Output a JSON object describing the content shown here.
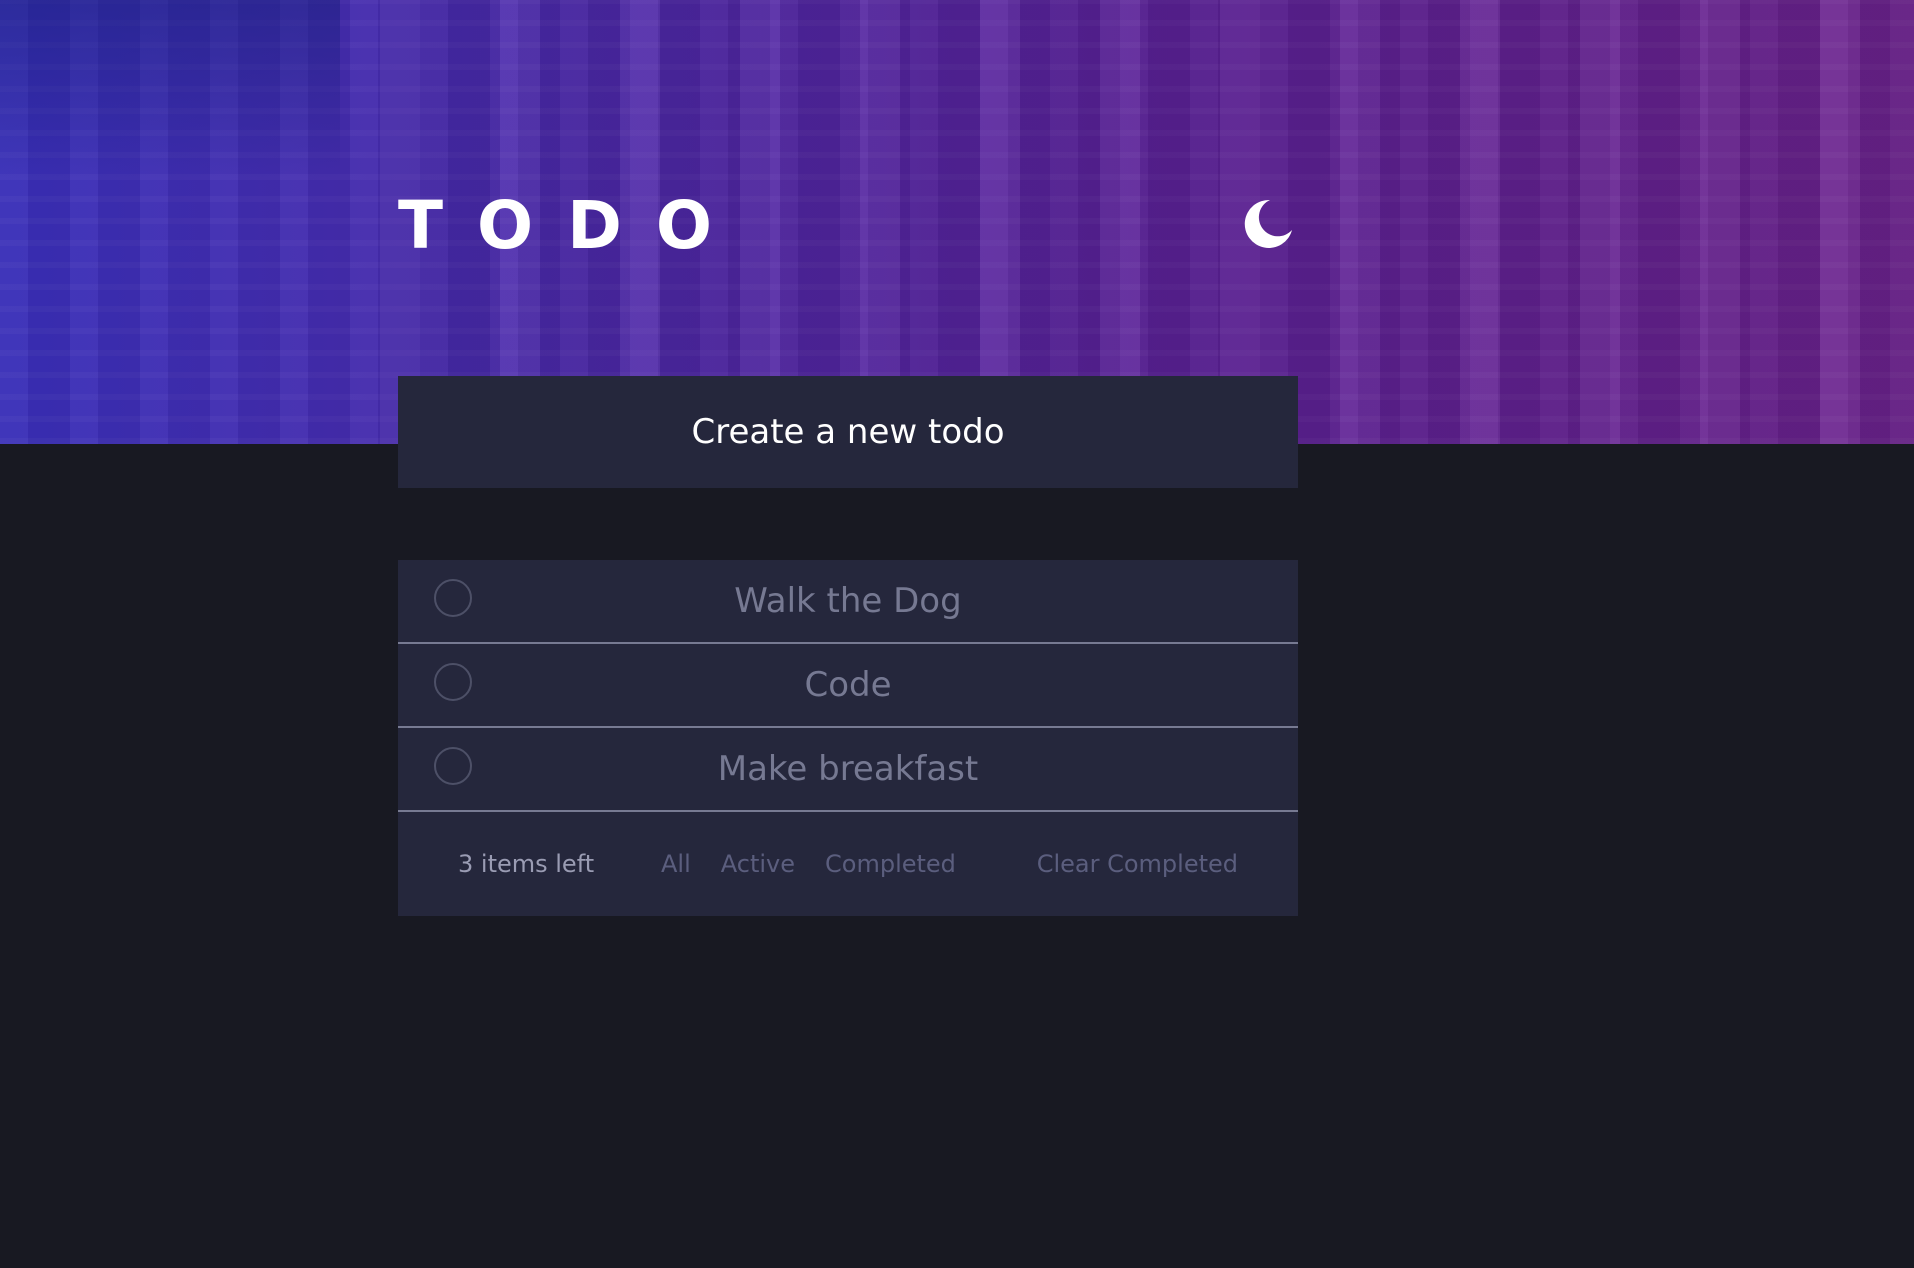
{
  "header": {
    "title": "TODO",
    "theme_toggle_icon": "moon-icon"
  },
  "new_todo": {
    "placeholder": "Create a new todo"
  },
  "todos": [
    {
      "text": "Walk the Dog",
      "completed": false
    },
    {
      "text": "Code",
      "completed": false
    },
    {
      "text": "Make breakfast",
      "completed": false
    }
  ],
  "footer": {
    "items_left": "3 items left",
    "filters": [
      "All",
      "Active",
      "Completed"
    ],
    "clear_label": "Clear Completed"
  },
  "colors": {
    "background": "#181922",
    "card": "#25273c",
    "text_muted": "#767992",
    "accent_gradient_start": "#3a2fb8",
    "accent_gradient_end": "#6c2389"
  }
}
